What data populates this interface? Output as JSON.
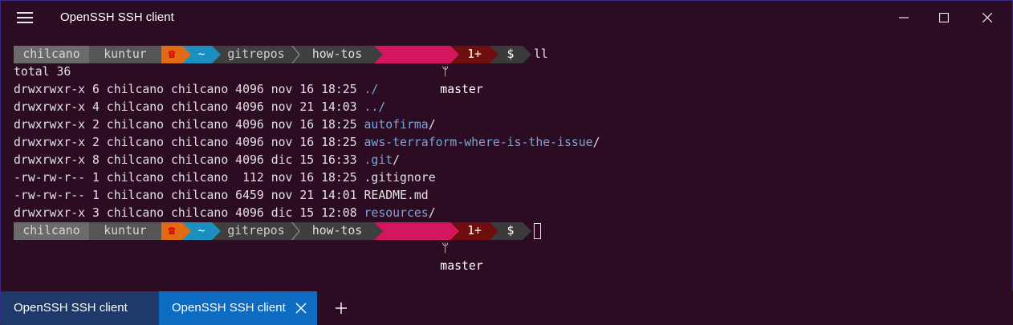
{
  "window": {
    "title": "OpenSSH SSH client"
  },
  "prompt": {
    "user": "chilcano",
    "host": "kuntur",
    "home": "~",
    "path1": "gitrepos",
    "path2": "how-tos",
    "branch": "master",
    "changes": "1+",
    "symbol": "$"
  },
  "commands": {
    "first": "ll"
  },
  "listing": {
    "total": "total 36",
    "rows": [
      {
        "meta": "drwxrwxr-x 6 chilcano chilcano 4096 nov 16 18:25 ",
        "name": "./",
        "suffix": "",
        "is_dir": true
      },
      {
        "meta": "drwxrwxr-x 4 chilcano chilcano 4096 nov 21 14:03 ",
        "name": "../",
        "suffix": "",
        "is_dir": true
      },
      {
        "meta": "drwxrwxr-x 2 chilcano chilcano 4096 nov 16 18:25 ",
        "name": "autofirma",
        "suffix": "/",
        "is_dir": true
      },
      {
        "meta": "drwxrwxr-x 2 chilcano chilcano 4096 nov 16 18:25 ",
        "name": "aws-terraform-where-is-the-issue",
        "suffix": "/",
        "is_dir": true
      },
      {
        "meta": "drwxrwxr-x 8 chilcano chilcano 4096 dic 15 16:33 ",
        "name": ".git",
        "suffix": "/",
        "is_dir": true
      },
      {
        "meta": "-rw-rw-r-- 1 chilcano chilcano  112 nov 16 18:25 ",
        "name": ".gitignore",
        "suffix": "",
        "is_dir": false
      },
      {
        "meta": "-rw-rw-r-- 1 chilcano chilcano 6459 nov 21 14:01 ",
        "name": "README.md",
        "suffix": "",
        "is_dir": false
      },
      {
        "meta": "drwxrwxr-x 3 chilcano chilcano 4096 dic 15 12:08 ",
        "name": "resources",
        "suffix": "/",
        "is_dir": true
      }
    ]
  },
  "tabs": [
    {
      "label": "OpenSSH SSH client",
      "active": false
    },
    {
      "label": "OpenSSH SSH client",
      "active": true
    }
  ],
  "icons": {
    "menu": "hamburger-icon",
    "minimize": "minimize-icon",
    "maximize": "maximize-icon",
    "close": "close-icon",
    "git_branch": "git-branch-icon",
    "prompt_status": "phone-icon",
    "new_tab": "plus-icon",
    "tab_close": "close-icon"
  },
  "colors": {
    "background": "#2c0c22",
    "seg_user": "#6b6b6b",
    "seg_host": "#555555",
    "seg_status": "#e36a15",
    "seg_home": "#1a8fc0",
    "seg_path": "#3f3f3f",
    "seg_branch": "#d3165e",
    "seg_changes": "#6e0e0e",
    "seg_symbol": "#3a3a3a",
    "directory": "#7aa6da",
    "tab_active": "#0e6bc2",
    "tab_inactive": "#1f3a6a"
  }
}
